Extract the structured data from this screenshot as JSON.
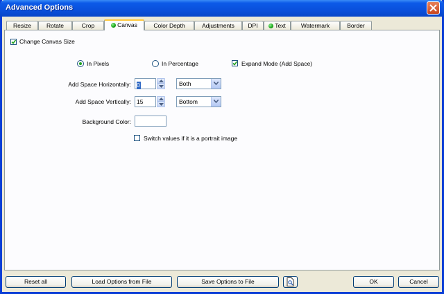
{
  "window": {
    "title": "Advanced Options"
  },
  "tabs": [
    {
      "label": "Resize",
      "dot": false
    },
    {
      "label": "Rotate",
      "dot": false
    },
    {
      "label": "Crop",
      "dot": false
    },
    {
      "label": "Canvas",
      "dot": true,
      "active": true
    },
    {
      "label": "Color Depth",
      "dot": false
    },
    {
      "label": "Adjustments",
      "dot": false
    },
    {
      "label": "DPI",
      "dot": false
    },
    {
      "label": "Text",
      "dot": true
    },
    {
      "label": "Watermark",
      "dot": false
    },
    {
      "label": "Border",
      "dot": false
    }
  ],
  "canvas": {
    "change_canvas_size": {
      "label": "Change Canvas Size",
      "checked": true
    },
    "mode": {
      "in_pixels": {
        "label": "In Pixels",
        "selected": true
      },
      "in_percentage": {
        "label": "In Percentage",
        "selected": false
      }
    },
    "expand_mode": {
      "label": "Expand Mode (Add Space)",
      "checked": true
    },
    "horizontal": {
      "label": "Add Space Horizontally:",
      "value": "0",
      "position": "Both"
    },
    "vertical": {
      "label": "Add Space Vertically:",
      "value": "15",
      "position": "Bottom"
    },
    "background_color": {
      "label": "Background Color:",
      "value": ""
    },
    "switch_portrait": {
      "label": "Switch values if it is a portrait image",
      "checked": false
    }
  },
  "footer": {
    "reset_all": "Reset all",
    "load_options": "Load Options from File",
    "save_options": "Save Options to File",
    "ok": "OK",
    "cancel": "Cancel"
  },
  "colors": {
    "titlebar": "#0a50dc",
    "window_bg": "#ece9d8",
    "panel_bg": "#fcfcfe",
    "active_tab_highlight": "#ffc83c",
    "indicator_green": "#17a317"
  }
}
